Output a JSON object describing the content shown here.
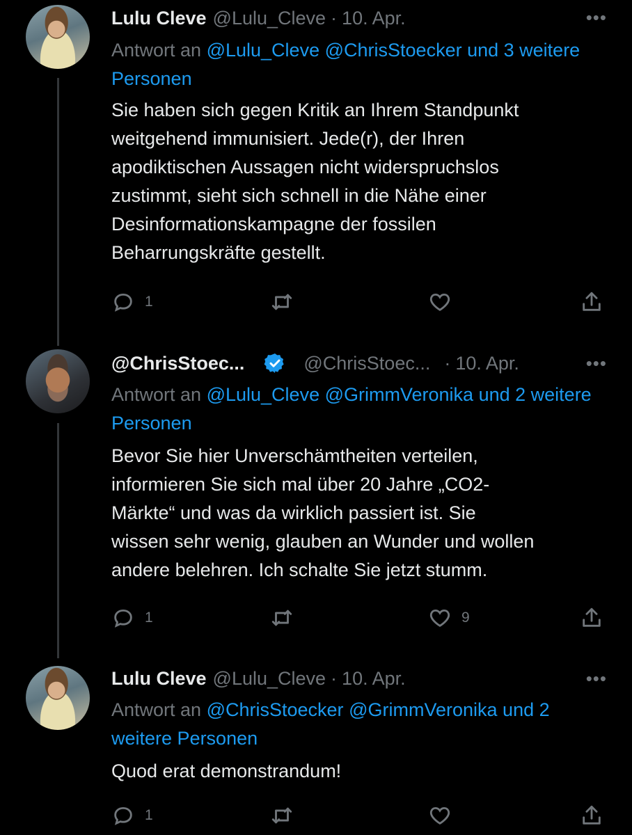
{
  "tweets": [
    {
      "name": "Lulu Cleve",
      "handle": "@Lulu_Cleve",
      "date": "10. Apr.",
      "more": "•••",
      "reply_prefix": "Antwort an ",
      "reply_links": [
        "@Lulu_Cleve",
        "@ChrisStoecker",
        "und 3 weitere Personen"
      ],
      "text_lines": [
        "Sie haben sich gegen Kritik an Ihrem Standpunkt",
        "weitgehend immunisiert. Jede(r), der Ihren",
        "apodiktischen Aussagen nicht widerspruchslos",
        "zustimmt, sieht sich schnell in die Nähe einer",
        "Desinformationskampagne der fossilen",
        "Beharrungskräfte gestellt."
      ],
      "reply_count": "1",
      "retweet_count": "",
      "like_count": ""
    },
    {
      "name": "@ChrisStoec...",
      "handle": "@ChrisStoec...",
      "date": "10. Apr.",
      "more": "•••",
      "reply_prefix": "Antwort an ",
      "reply_links": [
        "@Lulu_Cleve",
        "@GrimmVeronika",
        "und 2 weitere Personen"
      ],
      "text_lines": [
        "Bevor Sie hier Unverschämtheiten verteilen,",
        "informieren Sie sich mal über 20 Jahre „CO2-",
        "Märkte“ und was da wirklich passiert ist. Sie",
        "wissen sehr wenig, glauben an Wunder und wollen",
        "andere belehren. Ich schalte Sie jetzt stumm."
      ],
      "reply_count": "1",
      "retweet_count": "",
      "like_count": "9"
    },
    {
      "name": "Lulu Cleve",
      "handle": "@Lulu_Cleve",
      "date": "10. Apr.",
      "more": "•••",
      "reply_prefix": "Antwort an ",
      "reply_links": [
        "@ChrisStoecker",
        "@GrimmVeronika",
        "und 2 weitere Personen"
      ],
      "text_lines": [
        "Quod erat demonstrandum!"
      ],
      "reply_count": "1",
      "retweet_count": "",
      "like_count": ""
    }
  ],
  "icons": {
    "reply": "reply-icon",
    "retweet": "retweet-icon",
    "like": "heart-icon",
    "share": "share-icon",
    "verified": "verified-badge-icon"
  },
  "colors": {
    "background": "#000000",
    "text": "#e7e9ea",
    "muted": "#71767b",
    "link": "#1d9bf0"
  }
}
